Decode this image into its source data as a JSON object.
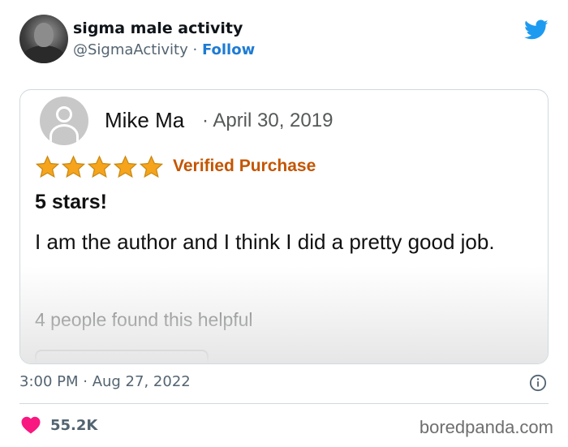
{
  "tweet": {
    "display_name": "sigma male activity",
    "handle": "@SigmaActivity",
    "separator": "·",
    "follow_label": "Follow",
    "timestamp": "3:00 PM · Aug 27, 2022",
    "like_count": "55.2K",
    "icons": [
      "twitter-bird-icon",
      "info-icon",
      "heart-icon"
    ],
    "brand_color": "#1d9bf0",
    "like_color": "#f91880"
  },
  "review": {
    "reviewer_name": "Mike Ma",
    "date": "· April 30, 2019",
    "rating": 5,
    "rating_max": 5,
    "verified_label": "Verified Purchase",
    "title": "5 stars!",
    "body": "I am the author and I think I did a pretty good job.",
    "helpful_text": "4 people found this helpful",
    "star_color": "#f6a41c",
    "verified_color": "#c45500"
  },
  "watermark": "boredpanda.com"
}
